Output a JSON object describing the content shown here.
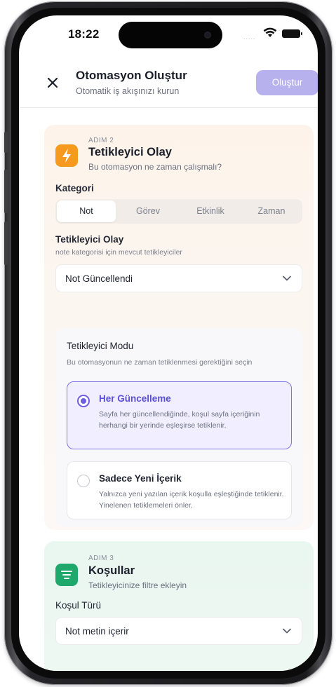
{
  "status_bar": {
    "time": "18:22",
    "signal": "....."
  },
  "header": {
    "title": "Otomasyon Oluştur",
    "subtitle": "Otomatik iş akışınızı kurun",
    "create_label": "Oluştur"
  },
  "step2": {
    "step_label": "ADIM 2",
    "title": "Tetikleyici Olay",
    "subtitle": "Bu otomasyon ne zaman çalışmalı?",
    "category_label": "Kategori",
    "categories": [
      "Not",
      "Görev",
      "Etkinlik",
      "Zaman"
    ],
    "selected_category": "Not",
    "trigger_label": "Tetikleyici Olay",
    "trigger_hint": "note kategorisi için mevcut tetikleyiciler",
    "trigger_value": "Not Güncellendi",
    "mode": {
      "title": "Tetikleyici Modu",
      "hint": "Bu otomasyonun ne zaman tetiklenmesi gerektiğini seçin",
      "options": [
        {
          "title": "Her Güncelleme",
          "desc": "Sayfa her güncellendiğinde, koşul sayfa içeriğinin herhangi bir yerinde eşleşirse tetiklenir.",
          "selected": true
        },
        {
          "title": "Sadece Yeni İçerik",
          "desc": "Yalnızca yeni yazılan içerik koşulla eşleştiğinde tetiklenir. Yinelenen tetiklemeleri önler.",
          "selected": false
        }
      ]
    }
  },
  "step3": {
    "step_label": "ADIM 3",
    "title": "Koşullar",
    "subtitle": "Tetikleyicinize filtre ekleyin",
    "condition_type_label": "Koşul Türü",
    "condition_type_value": "Not metin içerir"
  },
  "colors": {
    "accent": "#6d5fe0",
    "create_button": "#b7b1ee",
    "step2_icon": "#f59a1e",
    "step3_icon": "#1ea86b"
  },
  "icons": {
    "close": "close-icon",
    "step2": "lightning-icon",
    "step3": "filter-lines-icon",
    "dropdown": "chevron-down-icon"
  }
}
